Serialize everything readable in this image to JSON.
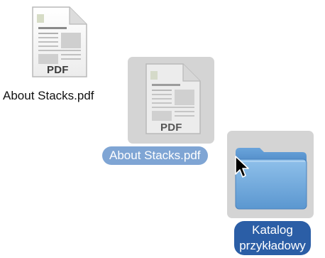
{
  "desktop": {
    "items": [
      {
        "label": "About Stacks.pdf",
        "badge": "PDF"
      },
      {
        "label": "About Stacks.pdf",
        "badge": "PDF"
      }
    ],
    "folder": {
      "label_line1": "Katalog",
      "label_line2": "przykładowy"
    }
  },
  "colors": {
    "selection_bg": "#d4d4d4",
    "drag_label_bg": "#7fa5d4",
    "folder_label_bg": "#2b5ea6",
    "folder_blue": "#6fa8dc"
  },
  "icons": {
    "file": "pdf-document-icon",
    "folder": "folder-icon",
    "cursor": "arrow-cursor-icon"
  }
}
